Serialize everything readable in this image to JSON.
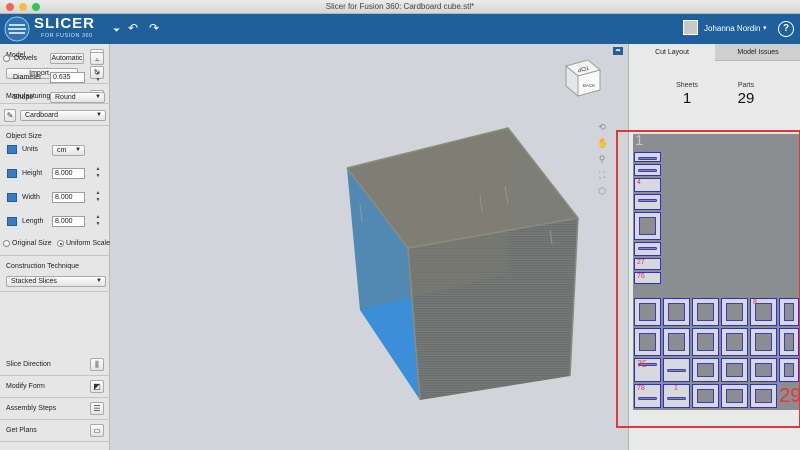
{
  "window": {
    "title": "Slicer for Fusion 360: Cardboard cube.stl*"
  },
  "header": {
    "logo_word": "SLICER",
    "logo_sub": "FOR FUSION 360",
    "user_name": "Johanna Nordin",
    "help_label": "?"
  },
  "left": {
    "model_label": "Model",
    "import_label": "Import...",
    "manufacturing_label": "Manufacturing Settings",
    "material_value": "Cardboard",
    "object_size_label": "Object Size",
    "units_label": "Units",
    "units_value": "cm",
    "height_label": "Height",
    "height_value": "8.000",
    "width_label": "Width",
    "width_value": "8.000",
    "length_label": "Length",
    "length_value": "8.000",
    "original_size_label": "Original Size",
    "uniform_scale_label": "Uniform Scale",
    "construction_label": "Construction Technique",
    "construction_value": "Stacked Slices",
    "dowels_label": "Dowels",
    "dowels_mode": "Automatic",
    "diameter_label": "Diameter",
    "diameter_value": "0.635",
    "shape_label": "Shape",
    "shape_value": "Round",
    "slice_direction_label": "Slice Direction",
    "modify_form_label": "Modify Form",
    "assembly_steps_label": "Assembly Steps",
    "get_plans_label": "Get Plans"
  },
  "viewcube": {
    "top": "TOP",
    "back": "BACK"
  },
  "right": {
    "tab_cut_layout": "Cut Layout",
    "tab_model_issues": "Model Issues",
    "sheets_label": "Sheets",
    "sheets_value": "1",
    "parts_label": "Parts",
    "parts_value": "29",
    "sheet_number": "1",
    "part_labels": [
      "4",
      "27",
      "76",
      "8",
      "75",
      "78",
      "1"
    ],
    "big_label": "29"
  },
  "colors": {
    "header_blue": "#1e5f9c",
    "highlight_red": "#e0393b",
    "part_outline": "#2b2fd6",
    "cube_side": "#3a8fd8"
  }
}
